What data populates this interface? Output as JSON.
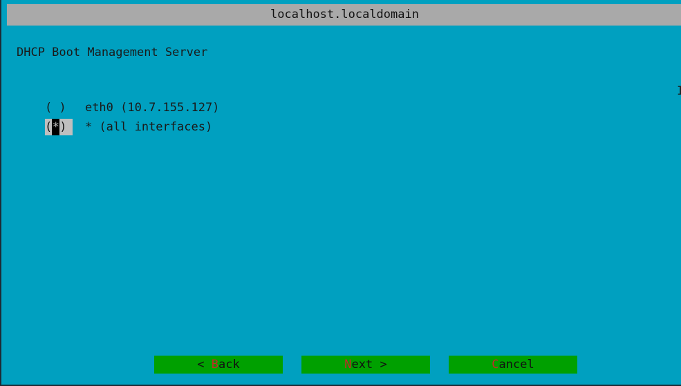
{
  "window": {
    "title": "localhost.localdomain"
  },
  "dialog": {
    "heading": "DHCP Boot Management Server",
    "options": [
      {
        "radio_left": "( ",
        "radio_mark": " ",
        "radio_right": ")",
        "label": "eth0 (10.7.155.127)",
        "selected": false
      },
      {
        "radio_left": "(",
        "radio_mark": "*",
        "radio_right": ")",
        "label": "* (all interfaces)",
        "selected": true
      }
    ],
    "scroll_indicator": "I"
  },
  "buttons": {
    "back": {
      "prefix": "< ",
      "hotkey": "B",
      "rest": "ack"
    },
    "next": {
      "prefix": "",
      "hotkey": "N",
      "rest": "ext >"
    },
    "cancel": {
      "prefix": "",
      "hotkey": "C",
      "rest": "ancel"
    }
  },
  "colors": {
    "background": "#00a0c0",
    "titlebar": "#a9a9a9",
    "button": "#00a000",
    "hotkey": "#c62828",
    "radio_selected_bg": "#bfbfbf"
  }
}
